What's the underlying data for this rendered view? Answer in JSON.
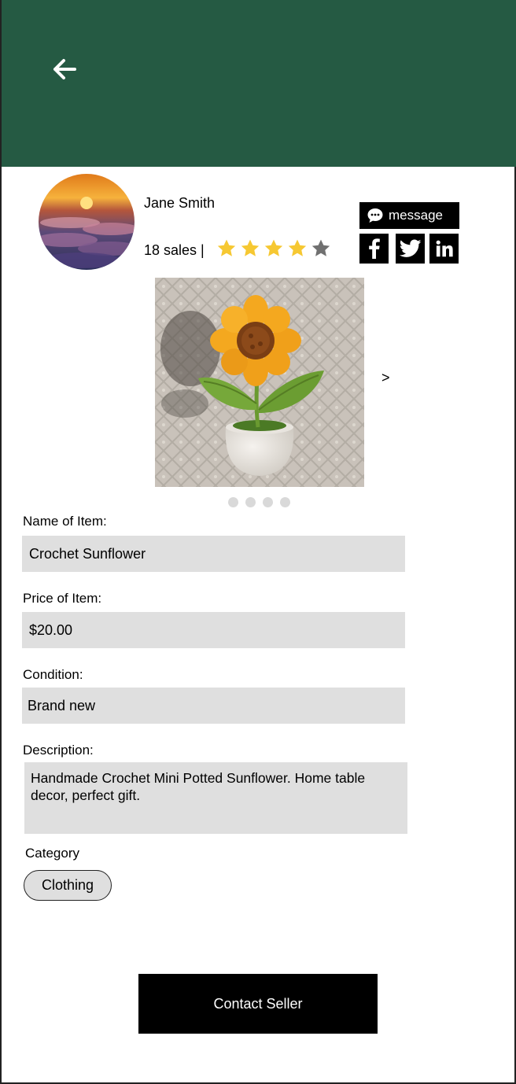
{
  "colors": {
    "header": "#255a43",
    "field": "#dfdfdf",
    "star_filled": "#f6c832",
    "star_empty": "#707070"
  },
  "seller": {
    "name": "Jane Smith",
    "sales": "18 sales |",
    "rating": 4,
    "rating_max": 5,
    "message_label": "message"
  },
  "carousel": {
    "next_label": ">",
    "pages": 4
  },
  "fields": {
    "name_label": "Name of Item:",
    "name_value": "Crochet Sunflower",
    "price_label": "Price of Item:",
    "price_value": "$20.00",
    "condition_label": "Condition:",
    "condition_value": "Brand new",
    "description_label": "Description:",
    "description_value": "Handmade Crochet Mini Potted Sunflower. Home table decor, perfect gift.",
    "category_label": "Category",
    "category_value": "Clothing"
  },
  "actions": {
    "contact_label": "Contact Seller"
  },
  "icons": {
    "back": "arrow-left-icon",
    "message": "chat-bubble-icon",
    "facebook": "facebook-icon",
    "twitter": "twitter-icon",
    "linkedin": "linkedin-icon"
  }
}
